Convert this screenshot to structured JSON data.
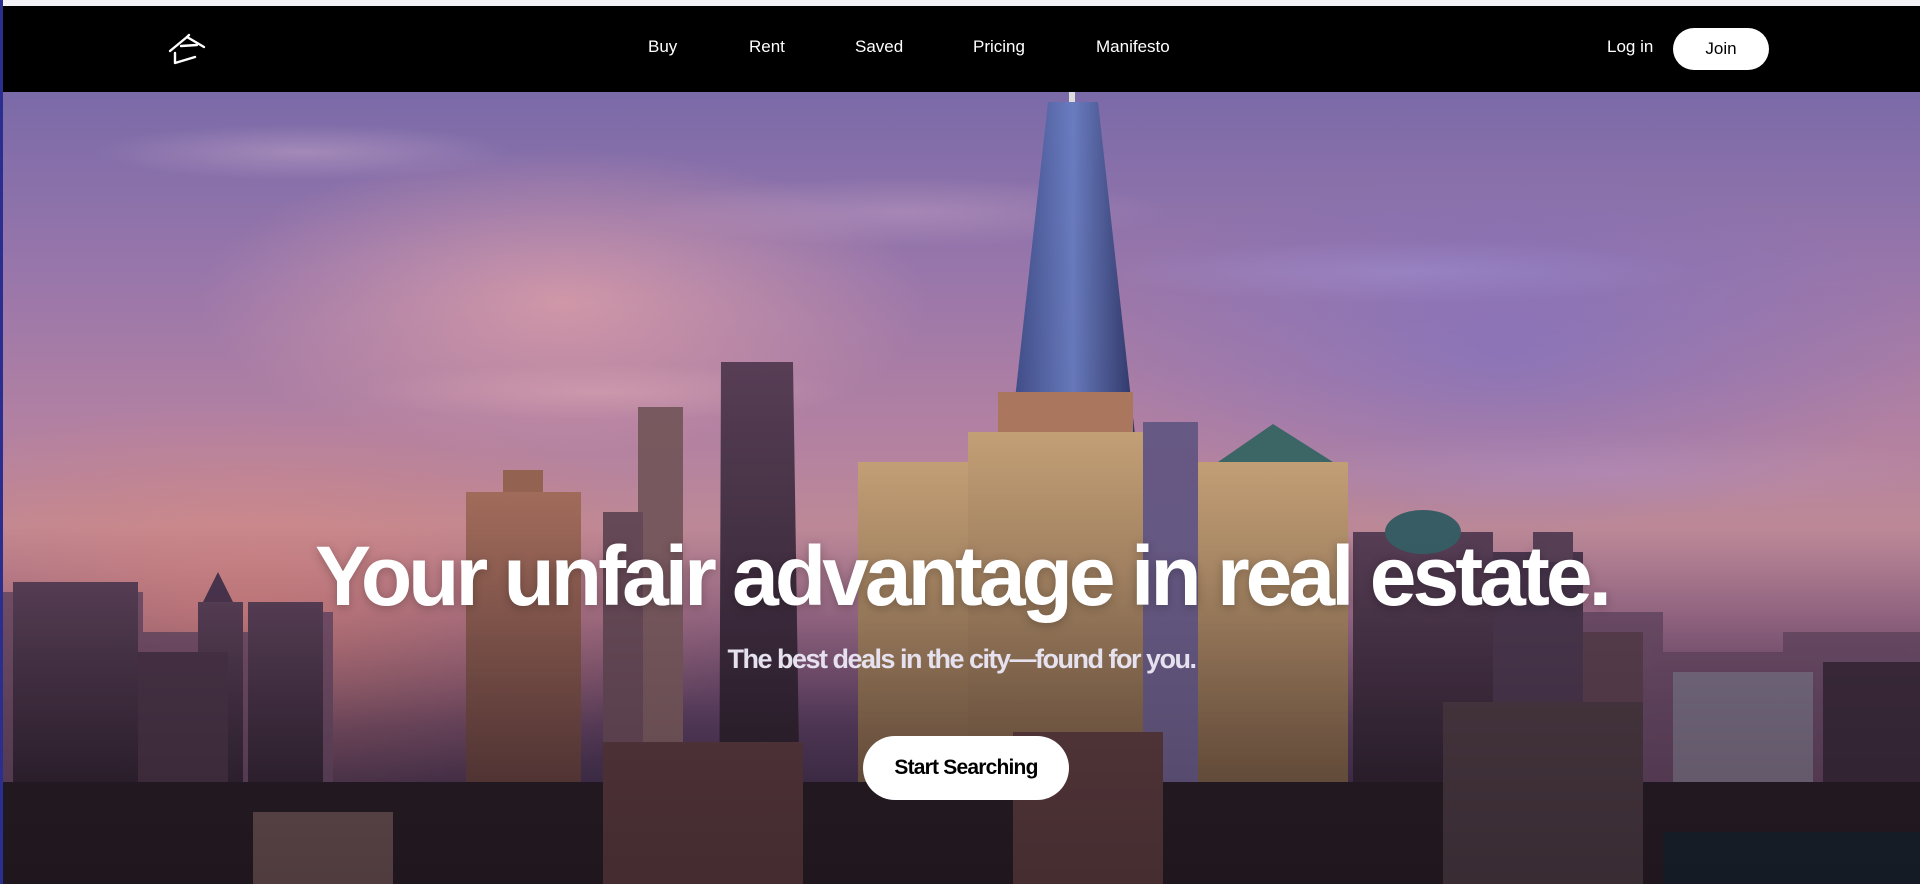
{
  "nav": {
    "logo_icon": "house-logo-icon",
    "links": [
      {
        "label": "Buy"
      },
      {
        "label": "Rent"
      },
      {
        "label": "Saved"
      },
      {
        "label": "Pricing"
      },
      {
        "label": "Manifesto"
      }
    ],
    "login_label": "Log in",
    "join_label": "Join"
  },
  "hero": {
    "headline": "Your unfair advantage in real estate.",
    "subheadline": "The best deals in the city—found for you.",
    "cta_label": "Start Searching"
  },
  "colors": {
    "navbar_bg": "#000000",
    "button_bg": "#ffffff",
    "button_text": "#000000",
    "headline": "#ffffff"
  }
}
